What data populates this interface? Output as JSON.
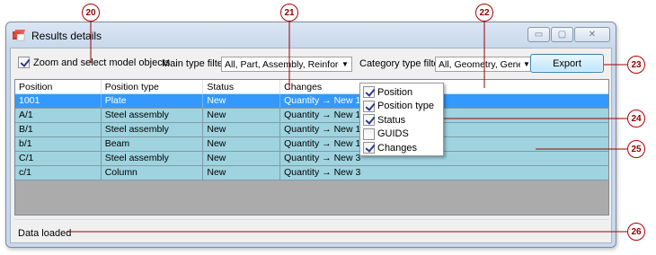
{
  "window": {
    "title": "Results details",
    "controls": {
      "minimize": "▭",
      "maximize": "▢",
      "close": "✕"
    }
  },
  "toolbar": {
    "zoom_checkbox_label": "Zoom and select model objects",
    "zoom_checked": true,
    "main_type_filter_label": "Main type filter",
    "main_type_filter_value": "All, Part, Assembly, Reinforcem",
    "category_type_filter_label": "Category type filter",
    "category_type_filter_value": "All, Geometry, General",
    "export_label": "Export"
  },
  "table": {
    "columns": [
      "Position",
      "Position type",
      "Status",
      "Changes"
    ],
    "rows": [
      {
        "position": "1001",
        "type": "Plate",
        "status": "New",
        "changes": "Quantity → New 1",
        "selected": true
      },
      {
        "position": "A/1",
        "type": "Steel assembly",
        "status": "New",
        "changes": "Quantity → New 1"
      },
      {
        "position": "B/1",
        "type": "Steel assembly",
        "status": "New",
        "changes": "Quantity → New 1"
      },
      {
        "position": "b/1",
        "type": "Beam",
        "status": "New",
        "changes": "Quantity → New 1"
      },
      {
        "position": "C/1",
        "type": "Steel assembly",
        "status": "New",
        "changes": "Quantity → New 3"
      },
      {
        "position": "c/1",
        "type": "Column",
        "status": "New",
        "changes": "Quantity → New 3"
      }
    ]
  },
  "column_menu": {
    "items": [
      {
        "label": "Position",
        "checked": true
      },
      {
        "label": "Position type",
        "checked": true
      },
      {
        "label": "Status",
        "checked": true
      },
      {
        "label": "GUIDS",
        "checked": false
      },
      {
        "label": "Changes",
        "checked": true
      }
    ]
  },
  "status_bar": {
    "text": "Data loaded"
  },
  "callouts": [
    "20",
    "21",
    "22",
    "23",
    "24",
    "25",
    "26"
  ],
  "colors": {
    "callout": "#b30000",
    "row_bg": "#9fd3df",
    "selected_row": "#3399ff",
    "export_button": "#bee6fd"
  }
}
